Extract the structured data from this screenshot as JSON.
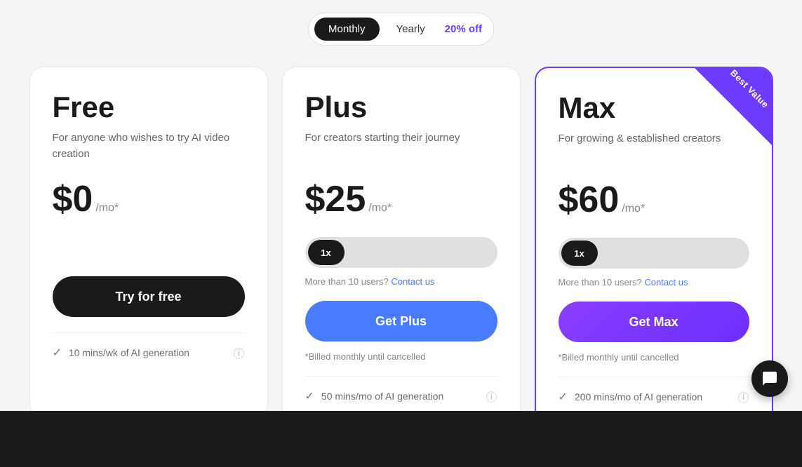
{
  "billing": {
    "toggle_label_monthly": "Monthly",
    "toggle_label_yearly": "Yearly",
    "discount_label": "20% off",
    "active": "monthly"
  },
  "plans": [
    {
      "id": "free",
      "name": "Free",
      "description": "For anyone who wishes to try AI video creation",
      "price": "$0",
      "period": "/mo*",
      "button_label": "Try for free",
      "button_type": "free",
      "featured": false,
      "best_value": false,
      "billed_note": "",
      "show_slider": false,
      "feature_preview": "10 mins/wk of AI generation"
    },
    {
      "id": "plus",
      "name": "Plus",
      "description": "For creators starting their journey",
      "price": "$25",
      "period": "/mo*",
      "button_label": "Get Plus",
      "button_type": "plus",
      "featured": false,
      "best_value": false,
      "billed_note": "*Billed monthly until cancelled",
      "show_slider": true,
      "slider_value": "1x",
      "more_users_text": "More than 10 users?",
      "contact_link": "Contact us",
      "feature_preview": "50 mins/mo of AI generation"
    },
    {
      "id": "max",
      "name": "Max",
      "description": "For growing & established creators",
      "price": "$60",
      "period": "/mo*",
      "button_label": "Get Max",
      "button_type": "max",
      "featured": true,
      "best_value": true,
      "best_value_text": "Best Value",
      "billed_note": "*Billed monthly until cancelled",
      "show_slider": true,
      "slider_value": "1x",
      "more_users_text": "More than 10 users?",
      "contact_link": "Contact us",
      "feature_preview": "200 mins/mo of AI generation"
    }
  ],
  "chat": {
    "icon": "chat"
  }
}
